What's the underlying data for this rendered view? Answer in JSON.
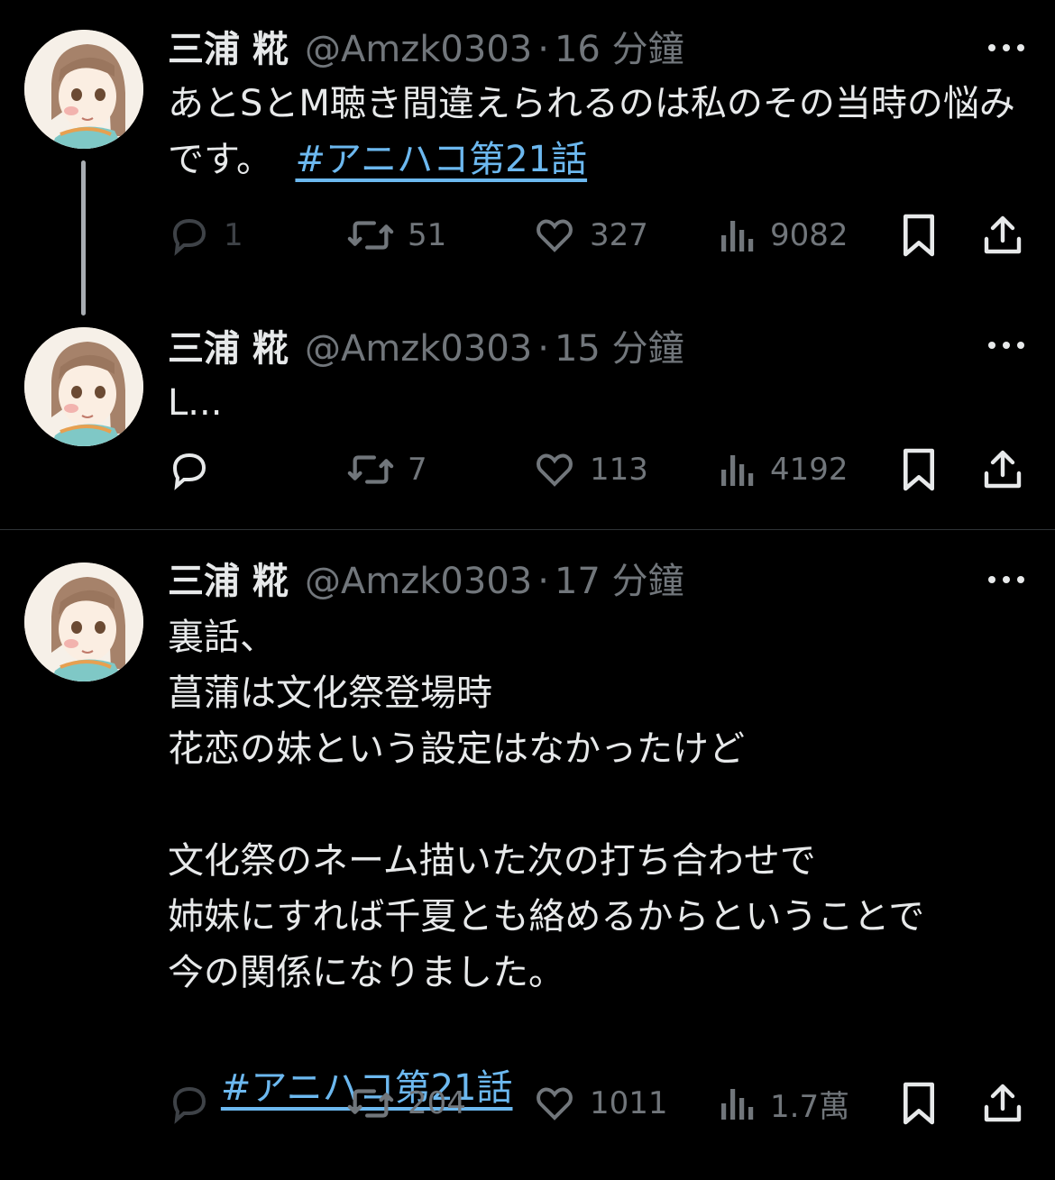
{
  "tweets": [
    {
      "name": "三浦 糀",
      "handle": "@Amzk0303",
      "sep": "·",
      "time": "16 分鐘",
      "text": "あとSとM聴き間違えられるのは私のその当時の悩みです。",
      "hashtag": "#アニハコ第21話",
      "replies": "1",
      "retweets": "51",
      "likes": "327",
      "views": "9082"
    },
    {
      "name": "三浦 糀",
      "handle": "@Amzk0303",
      "sep": "·",
      "time": "15 分鐘",
      "text": "L...",
      "replies": "",
      "retweets": "7",
      "likes": "113",
      "views": "4192"
    },
    {
      "name": "三浦 糀",
      "handle": "@Amzk0303",
      "sep": "·",
      "time": "17 分鐘",
      "text": "裏話、\n菖蒲は文化祭登場時\n花恋の妹という設定はなかったけど\n\n文化祭のネーム描いた次の打ち合わせで\n姉妹にすれば千夏とも絡めるからということで\n今の関係になりました。",
      "hashtag": "#アニハコ第21話",
      "replies": "",
      "retweets": "204",
      "likes": "1011",
      "views": "1.7萬"
    }
  ],
  "icons": {
    "reply": "reply-icon",
    "retweet": "retweet-icon",
    "like": "heart-icon",
    "views": "views-icon",
    "bookmark": "bookmark-icon",
    "share": "share-icon",
    "more": "more-icon"
  },
  "colors": {
    "background": "#000000",
    "text": "#e7e9ea",
    "secondary": "#71767b",
    "hashtag": "#6cb8ef",
    "thread_line": "#a8adb2"
  }
}
